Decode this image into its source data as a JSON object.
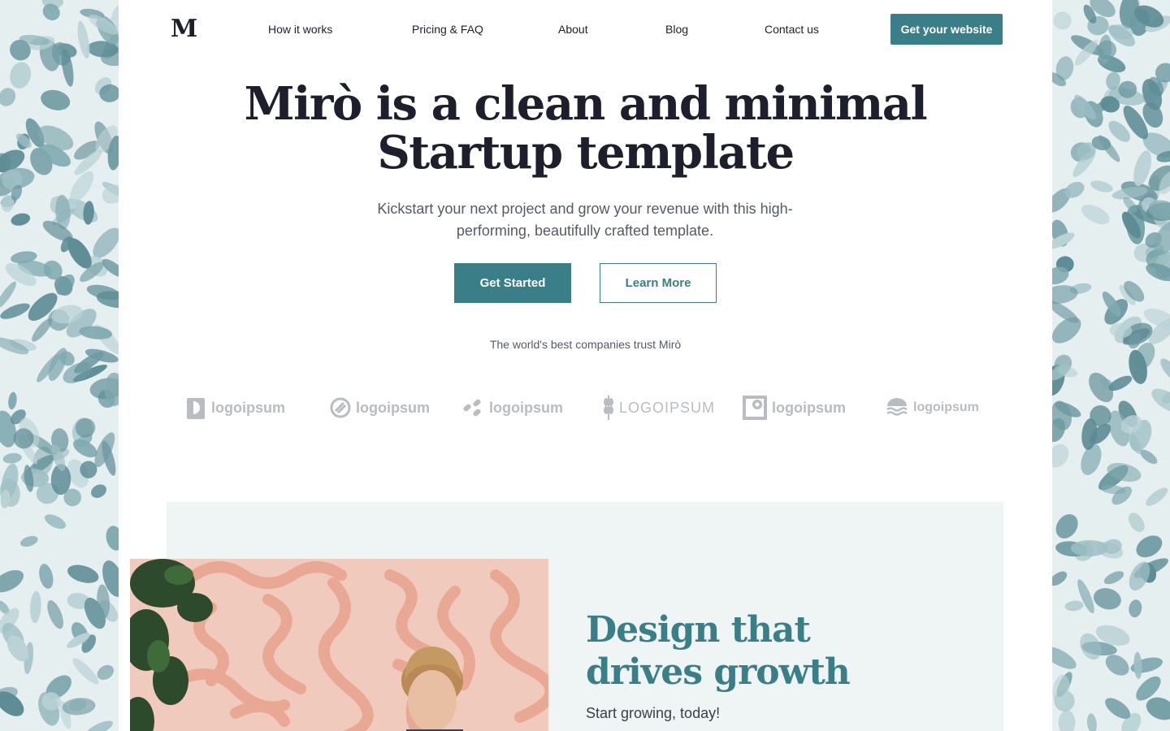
{
  "nav": {
    "logo": "M",
    "links": [
      "How it works",
      "Pricing & FAQ",
      "About",
      "Blog",
      "Contact us"
    ],
    "cta": "Get your website"
  },
  "hero": {
    "title_line1": "Mirò is a clean and minimal",
    "title_line2": "Startup template",
    "subtitle": "Kickstart your next project and grow your revenue with this high-performing, beautifully crafted template.",
    "primary_button": "Get Started",
    "secondary_button": "Learn More",
    "trust_text": "The world's best companies trust Mirò"
  },
  "logos": [
    "logoipsum",
    "logoipsum",
    "logoipsum",
    "LOGOIPSUM",
    "logoipsum",
    "logoipsum"
  ],
  "feature": {
    "title": "Design that drives growth",
    "subtitle": "Start growing, today!"
  },
  "colors": {
    "accent": "#3a7f87",
    "heading": "#1d1f2c",
    "logo_gray": "#b9bcc2",
    "section_bg": "#eff4f4"
  }
}
